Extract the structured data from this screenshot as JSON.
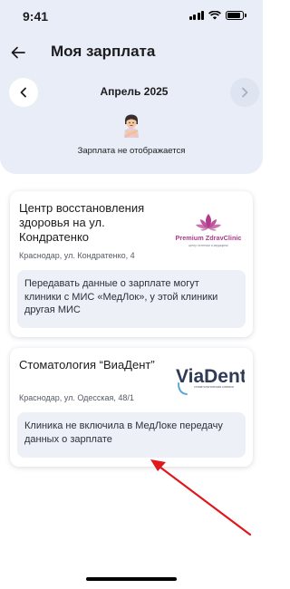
{
  "status_bar": {
    "time": "9:41"
  },
  "header": {
    "title": "Моя зарплата"
  },
  "month_nav": {
    "label": "Апрель 2025"
  },
  "salary_status": {
    "text": "Зарплата не отображается",
    "icon": "person-crossing-arms-emoji"
  },
  "clinics": [
    {
      "name": "Центр восстановления здоровья на ул. Кондратенко",
      "address": "Краснодар, ул. Кондратенко, 4",
      "message": "Передавать данные о зарплате могут клиники с МИС «МедЛок», у этой клиники другая МИС",
      "logo": {
        "brand": "Premium ZdravClinic",
        "tagline": "центр эстетики и медицины",
        "color": "#b03a8c"
      }
    },
    {
      "name": "Стоматология “ВиаДент”",
      "address": "Краснодар, ул. Одесская, 48/1",
      "message": "Клиника не включила в МедЛоке передачу данных о зарплате",
      "logo": {
        "brand": "ViaDent",
        "tagline": "стоматологическая клиника",
        "color": "#2f3a56"
      }
    }
  ],
  "colors": {
    "header_bg": "#e9edf8",
    "info_bg": "#eef0f8",
    "annotation_arrow": "#e0191e"
  }
}
